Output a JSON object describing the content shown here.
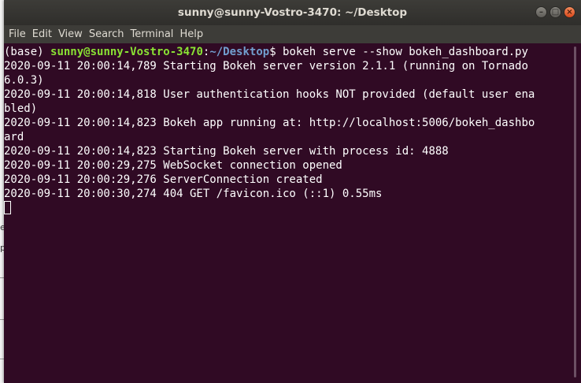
{
  "window": {
    "title": "sunny@sunny-Vostro-3470: ~/Desktop",
    "buttons": {
      "minimize": "–",
      "maximize": "□",
      "close": "×"
    }
  },
  "menu": [
    "File",
    "Edit",
    "View",
    "Search",
    "Terminal",
    "Help"
  ],
  "terminal": {
    "prompt": {
      "env": "(base) ",
      "user_host": "sunny@sunny-Vostro-3470",
      "sep": ":",
      "path": "~/Desktop",
      "symbol": "$ ",
      "command": "bokeh serve --show bokeh_dashboard.py"
    },
    "lines": [
      "2020-09-11 20:00:14,789 Starting Bokeh server version 2.1.1 (running on Tornado",
      "6.0.3)",
      "2020-09-11 20:00:14,818 User authentication hooks NOT provided (default user ena",
      "bled)",
      "2020-09-11 20:00:14,823 Bokeh app running at: http://localhost:5006/bokeh_dashbo",
      "ard",
      "2020-09-11 20:00:14,823 Starting Bokeh server with process id: 4888",
      "2020-09-11 20:00:29,275 WebSocket connection opened",
      "2020-09-11 20:00:29,276 ServerConnection created",
      "2020-09-11 20:00:30,274 404 GET /favicon.ico (::1) 0.55ms"
    ]
  },
  "background": {
    "glyph_1": "e",
    "glyph_2": "p"
  },
  "colors": {
    "terminal_bg": "#300a24",
    "prompt_user": "#8ae234",
    "prompt_path": "#729fcf",
    "titlebar": "#3d3c38"
  }
}
